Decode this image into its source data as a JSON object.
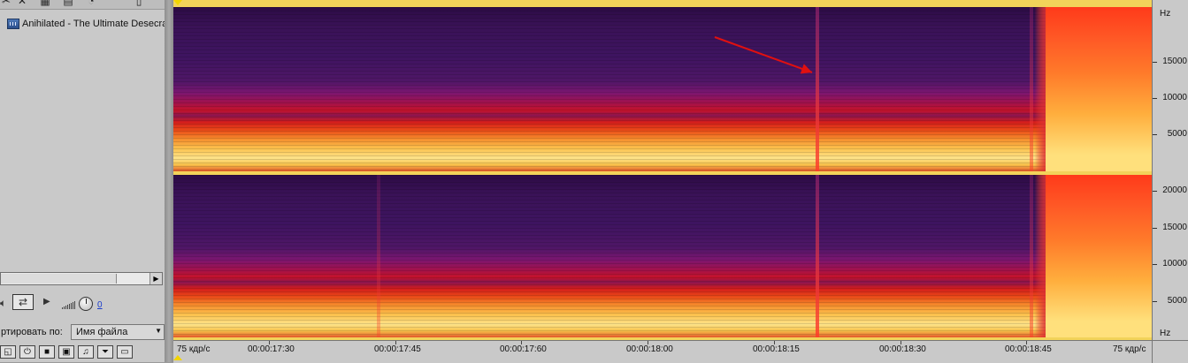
{
  "file_panel": {
    "file_name": "Anihilated - The Ultimate Desecra",
    "volume_value": "0",
    "sort_label": "ртировать по:",
    "sort_value": "Имя файла"
  },
  "frequency_axis": {
    "unit": "Hz",
    "channel1_labels": [
      "15000",
      "10000",
      "5000"
    ],
    "channel2_labels": [
      "20000",
      "15000",
      "10000",
      "5000"
    ]
  },
  "time_axis": {
    "left_label": "75 кдр/с",
    "labels": [
      "00:00:17:30",
      "00:00:17:45",
      "00:00:17:60",
      "00:00:18:00",
      "00:00:18:15",
      "00:00:18:30",
      "00:00:18:45"
    ],
    "right_label": "75 кдр/с"
  },
  "colors": {
    "marker": "#f3d400",
    "annotation_arrow": "#e01010"
  },
  "icons": {
    "toolbar": [
      "cut-icon",
      "view-icon",
      "grid-icon",
      "clock-icon",
      "window-icon"
    ],
    "transport": [
      "speaker-icon",
      "loop-icon",
      "play-icon"
    ],
    "bottom": [
      "select-icon",
      "power-icon",
      "stop-icon",
      "film-icon",
      "music-icon",
      "filter-icon",
      "clip-icon"
    ]
  }
}
